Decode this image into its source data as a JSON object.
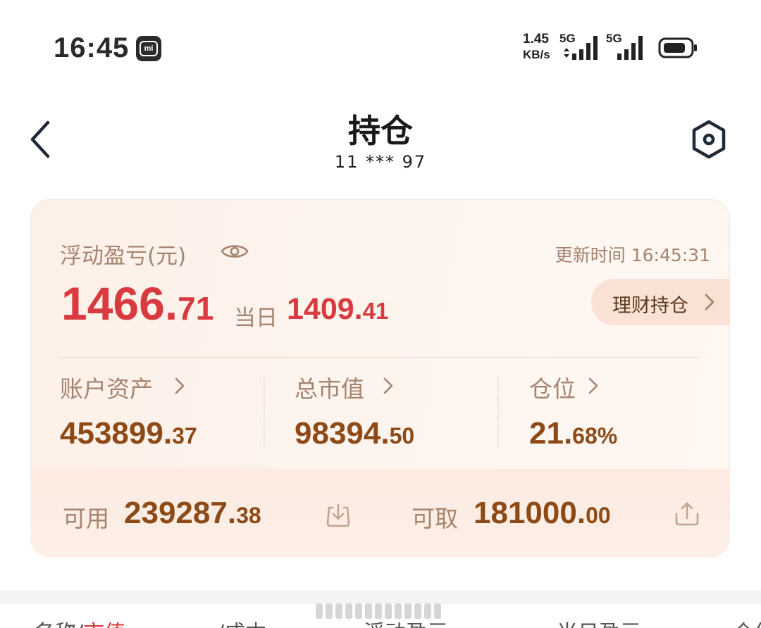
{
  "status_bar": {
    "time": "16:45",
    "net_speed_value": "1.45",
    "net_speed_unit": "KB/s",
    "signal1_label": "5G",
    "signal2_label": "5G",
    "badge_label": "mi"
  },
  "header": {
    "title": "持仓",
    "account": "11 *** 97"
  },
  "card": {
    "pnl_label": "浮动盈亏(元)",
    "update_label": "更新时间 16:45:31",
    "pnl_int": "1466.",
    "pnl_dec": "71",
    "today_label": "当日",
    "today_int": "1409.",
    "today_dec": "41",
    "wealth_button": "理财持仓",
    "stats": [
      {
        "label": "账户资产",
        "int": "453899.",
        "dec": "37"
      },
      {
        "label": "总市值",
        "int": "98394.",
        "dec": "50"
      },
      {
        "label": "仓位",
        "int": "21.",
        "dec": "68%"
      }
    ],
    "available_label": "可用",
    "available_int": "239287.",
    "available_dec": "38",
    "withdrawable_label": "可取",
    "withdrawable_int": "181000.",
    "withdrawable_dec": "00"
  },
  "table_header": {
    "col1_a": "名称/",
    "col1_b": "市值",
    "col2": "/成本",
    "col3": "浮动盈亏",
    "col4": "当日盈亏",
    "col5": "仓位"
  },
  "colors": {
    "accent_red": "#d83a3f",
    "value_brown": "#8e4a16",
    "label_tan": "#a5846f"
  }
}
